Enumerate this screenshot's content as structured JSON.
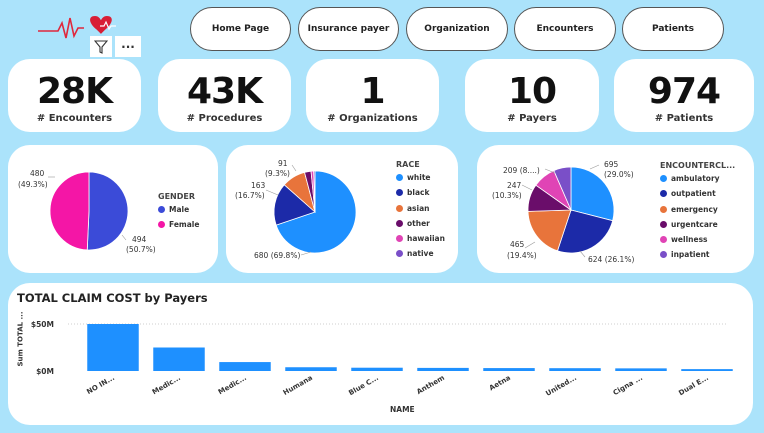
{
  "nav": [
    "Home Page",
    "Insurance payer",
    "Organization",
    "Encounters",
    "Patients"
  ],
  "toolbar": {
    "more_glyph": "···"
  },
  "kpis": [
    {
      "value": "28K",
      "label": "# Encounters"
    },
    {
      "value": "43K",
      "label": "# Procedures"
    },
    {
      "value": "1",
      "label": "# Organizations"
    },
    {
      "value": "10",
      "label": "# Payers"
    },
    {
      "value": "974",
      "label": "# Patients"
    }
  ],
  "gender": {
    "legend_title": "GENDER",
    "items": [
      {
        "name": "Male",
        "value": 494,
        "label_line1": "494",
        "label_line2": "(50.7%)",
        "color": "#3b4bd8"
      },
      {
        "name": "Female",
        "value": 480,
        "label_line1": "480",
        "label_line2": "(49.3%)",
        "color": "#f416a6"
      }
    ]
  },
  "race": {
    "legend_title": "RACE",
    "items": [
      {
        "name": "white",
        "value": 680,
        "color": "#1e90ff"
      },
      {
        "name": "black",
        "value": 163,
        "color": "#1c2aa8"
      },
      {
        "name": "asian",
        "value": 91,
        "color": "#e8743b"
      },
      {
        "name": "other",
        "value": 25,
        "color": "#6a0d6a"
      },
      {
        "name": "hawaiian",
        "value": 10,
        "color": "#e044b5"
      },
      {
        "name": "native",
        "value": 5,
        "color": "#7a4fc8"
      }
    ],
    "labels": {
      "white": "680 (69.8%)",
      "black_1": "163",
      "black_2": "(16.7%)",
      "asian_1": "91",
      "asian_2": "(9.3%)"
    }
  },
  "encounter": {
    "legend_title": "ENCOUNTERCL...",
    "items": [
      {
        "name": "ambulatory",
        "value": 8160,
        "color": "#1e90ff"
      },
      {
        "name": "outpatient",
        "value": 7344,
        "color": "#1c2aa8"
      },
      {
        "name": "emergency",
        "value": 5459,
        "color": "#e8743b"
      },
      {
        "name": "urgentcare",
        "value": 2898,
        "color": "#6a0d6a"
      },
      {
        "name": "wellness",
        "value": 2440,
        "color": "#e044b5"
      },
      {
        "name": "inpatient",
        "value": 1840,
        "color": "#7a4fc8"
      }
    ],
    "labels": {
      "ambulatory_1": "695",
      "ambulatory_2": "(29.0%)",
      "outpatient": "624 (26.1%)",
      "emergency_1": "465",
      "emergency_2": "(19.4%)",
      "urgentcare_1": "247",
      "urgentcare_2": "(10.3%)",
      "wellness": "209 (8....)"
    }
  },
  "chart_data": {
    "type": "bar",
    "title": "TOTAL CLAIM COST by Payers",
    "xlabel": "NAME",
    "ylabel": "Sum TOTAL ...",
    "y_ticks": [
      "$50M",
      "$0M"
    ],
    "ylim": [
      0,
      60000000
    ],
    "categories": [
      "NO IN...",
      "Medic...",
      "Medic...",
      "Humana",
      "Blue C...",
      "Anthem",
      "Aetna",
      "United...",
      "Cigna ...",
      "Dual E..."
    ],
    "values": [
      50000000,
      25000000,
      9500000,
      4000000,
      3500000,
      3300000,
      3100000,
      3000000,
      2800000,
      2000000
    ],
    "grid": true,
    "color": "#1e90ff"
  }
}
